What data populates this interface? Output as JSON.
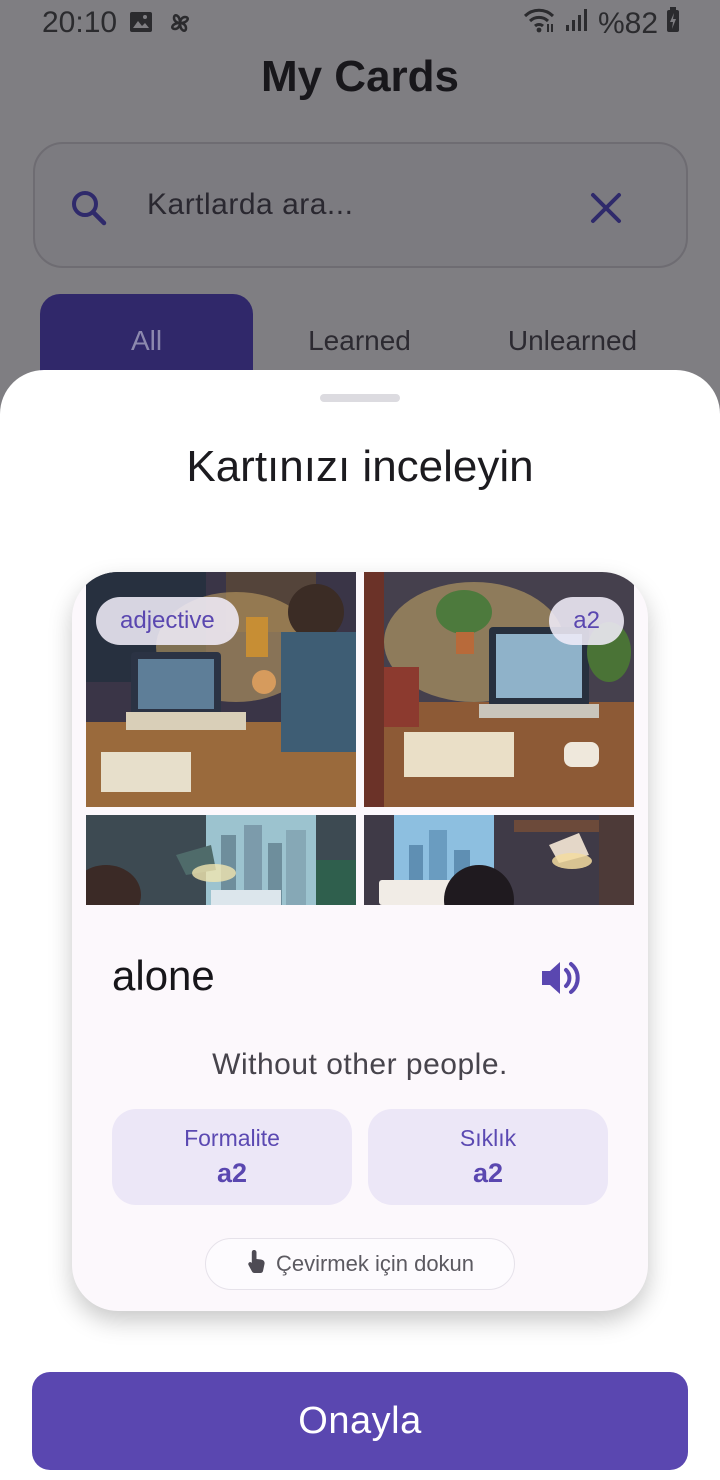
{
  "status_bar": {
    "time": "20:10",
    "battery": "%82",
    "icons": [
      "gallery-icon",
      "pinwheel-icon",
      "wifi-icon",
      "signal-icon",
      "battery-charging-icon"
    ]
  },
  "app": {
    "title": "My Cards"
  },
  "search": {
    "placeholder": "Kartlarda ara...",
    "icon": "search-icon",
    "clear_icon": "close-icon"
  },
  "tabs": [
    {
      "label": "All",
      "active": true
    },
    {
      "label": "Learned",
      "active": false
    },
    {
      "label": "Unlearned",
      "active": false
    }
  ],
  "sheet": {
    "title": "Kartınızı inceleyin",
    "card": {
      "part_of_speech": "adjective",
      "level": "a2",
      "word": "alone",
      "definition": "Without other people.",
      "stats": [
        {
          "label": "Formalite",
          "value": "a2"
        },
        {
          "label": "Sıklık",
          "value": "a2"
        }
      ],
      "flip_hint": "Çevirmek için dokun",
      "flip_icon": "tap-hand-icon",
      "audio_icon": "speaker-icon",
      "images": [
        "person-working-on-laptop-at-desk",
        "laptop-with-books-and-plants",
        "desk-lamp-by-city-window",
        "person-at-laptop-city-view"
      ]
    },
    "confirm_label": "Onayla"
  },
  "colors": {
    "accent": "#5a47b0",
    "tab_active_dimmed": "#30286a",
    "scrim_background": "#7f7e82",
    "chip_background": "#ece7f7"
  }
}
